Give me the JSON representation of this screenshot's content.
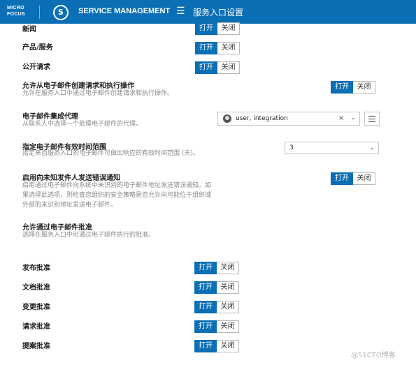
{
  "header": {
    "logo_line1": "MICRO",
    "logo_line2": "FOCUS",
    "app_name": "SERVICE MANAGEMENT",
    "menu_icon": "hamburger-menu-icon",
    "page_title": "服务入口设置"
  },
  "toggle": {
    "on": "打开",
    "off": "关闭"
  },
  "settings": {
    "news": {
      "label": "新闻"
    },
    "products": {
      "label": "产品/服务"
    },
    "public_requests": {
      "label": "公开请求"
    },
    "email_create": {
      "label": "允许从电子邮件创建请求和执行操作",
      "description": "允许在服务入口中通过电子邮件创建请求和执行操作。"
    },
    "email_agent": {
      "label": "电子邮件集成代理",
      "description": "从联系人中选择一个处理电子邮件的代理。",
      "value": "user, integration",
      "clear_icon": "×",
      "chevron_icon": "⌄"
    },
    "email_validity": {
      "label": "指定电子邮件有效时间范围",
      "description": "指定来自服务入口的电子邮件可做出响应的有效时间范围 (天)。",
      "value": "3",
      "chevron_icon": "⌄"
    },
    "unknown_sender": {
      "label": "启用向未知发件人发送错误通知",
      "description_lines": [
        "启用通过电子邮件向系统中未识别的电子邮件地址发送错误通知。如",
        "果选择此选项，则检查您组织的安全策略是否允许向可能位于组织域",
        "外部的未识别地址发送电子邮件。"
      ]
    },
    "email_approval": {
      "label": "允许通过电子邮件批准",
      "description": "选择在服务入口中可通过电子邮件执行的批准。"
    },
    "release_approval": {
      "label": "发布批准"
    },
    "document_approval": {
      "label": "文档批准"
    },
    "change_approval": {
      "label": "变更批准"
    },
    "request_approval": {
      "label": "请求批准"
    },
    "proposal_approval": {
      "label": "提案批准"
    }
  },
  "watermark": "@51CTO博客"
}
